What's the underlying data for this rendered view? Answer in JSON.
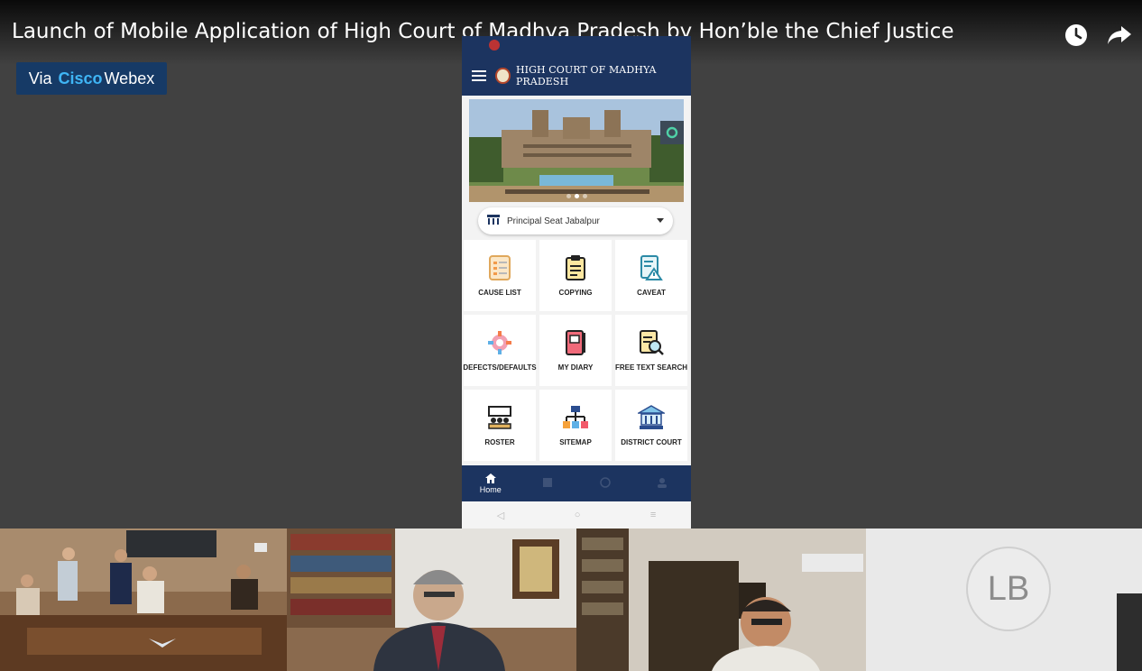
{
  "video": {
    "title": "Launch of Mobile Application of High Court of Madhya Pradesh by Hon’ble the Chief Justice",
    "icons": [
      "clock-icon",
      "share-icon"
    ]
  },
  "overlay": {
    "via": "Via",
    "brand": "Cisco",
    "product": "Webex"
  },
  "phone": {
    "app_title": "HIGH COURT OF MADHYA PRADESH",
    "seat_selected": "Principal Seat Jabalpur",
    "tiles": [
      {
        "label": "CAUSE LIST",
        "icon": "cause-list-icon"
      },
      {
        "label": "COPYING",
        "icon": "clipboard-icon"
      },
      {
        "label": "CAVEAT",
        "icon": "caveat-icon"
      },
      {
        "label": "DEFECTS/DEFAULTS",
        "icon": "gear-icon"
      },
      {
        "label": "MY DIARY",
        "icon": "diary-icon"
      },
      {
        "label": "FREE TEXT SEARCH",
        "icon": "search-document-icon"
      },
      {
        "label": "ROSTER",
        "icon": "roster-icon"
      },
      {
        "label": "SITEMAP",
        "icon": "sitemap-icon"
      },
      {
        "label": "DISTRICT COURT",
        "icon": "court-building-icon"
      }
    ],
    "nav": {
      "home": "Home"
    }
  },
  "participants": {
    "lb_initials": "LB"
  },
  "colors": {
    "app_navy": "#1c3460",
    "webex_blue": "#3fb5f5",
    "stage_gray": "#414141"
  }
}
